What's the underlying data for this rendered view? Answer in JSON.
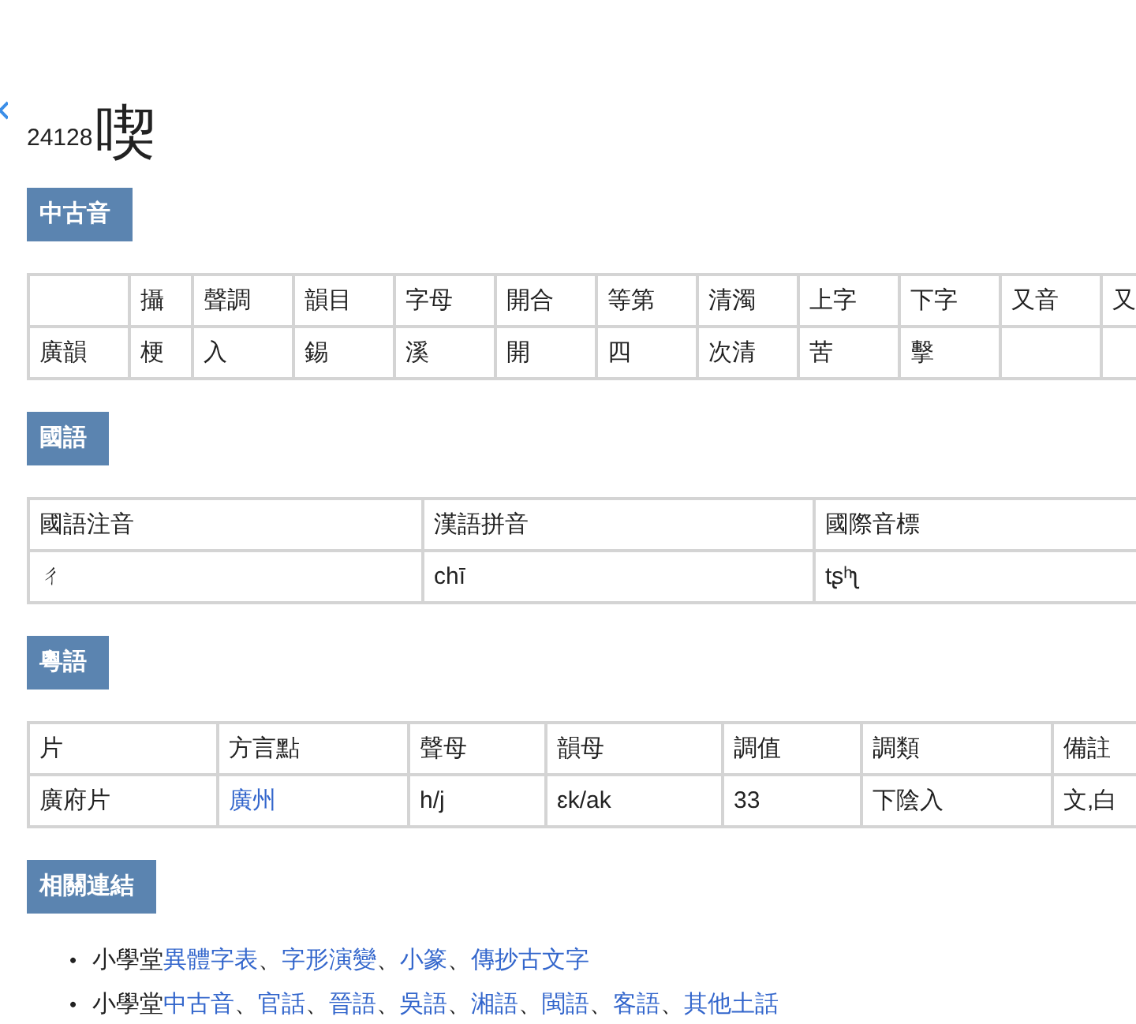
{
  "title": {
    "code": "24128",
    "character": "喫"
  },
  "sections": [
    {
      "heading": "中古音",
      "kind": "table",
      "columns": [
        null,
        "攝",
        "聲調",
        "韻目",
        "字母",
        "開合",
        "等第",
        "清濁",
        "上字",
        "下字",
        "又音",
        "又"
      ],
      "rows": [
        [
          {
            "text": "廣韻",
            "link": false
          },
          {
            "text": "梗",
            "link": false
          },
          {
            "text": "入",
            "link": false
          },
          {
            "text": "錫",
            "link": false
          },
          {
            "text": "溪",
            "link": false
          },
          {
            "text": "開",
            "link": false
          },
          {
            "text": "四",
            "link": false
          },
          {
            "text": "次清",
            "link": false
          },
          {
            "text": "苦",
            "link": false
          },
          {
            "text": "擊",
            "link": false
          },
          null,
          null
        ]
      ]
    },
    {
      "heading": "國語",
      "kind": "table",
      "columns": [
        "國語注音",
        "漢語拼音",
        "國際音標"
      ],
      "rows": [
        [
          {
            "text": "ㄔ",
            "link": false
          },
          {
            "text": "chī",
            "link": false
          },
          {
            "text": "tʂʰʅ",
            "link": false
          }
        ]
      ]
    },
    {
      "heading": "粵語",
      "kind": "table",
      "columns": [
        "片",
        "方言點",
        "聲母",
        "韻母",
        "調值",
        "調類",
        "備註"
      ],
      "rows": [
        [
          {
            "text": "廣府片",
            "link": false
          },
          {
            "text": "廣州",
            "link": true
          },
          {
            "text": "h/j",
            "link": false
          },
          {
            "text": "ɛk/ak",
            "link": false
          },
          {
            "text": "33",
            "link": false
          },
          {
            "text": "下陰入",
            "link": false
          },
          {
            "text": "文,白",
            "link": false
          }
        ]
      ]
    },
    {
      "heading": "相關連結",
      "kind": "list",
      "marker": "•",
      "separator": "、",
      "items": [
        {
          "prefix": "小學堂",
          "links": [
            "異體字表",
            "字形演變",
            "小篆",
            "傳抄古文字"
          ]
        },
        {
          "prefix": "小學堂",
          "links": [
            "中古音",
            "官話",
            "晉語",
            "吳語",
            "湘語",
            "閩語",
            "客語",
            "其他土話"
          ]
        }
      ]
    }
  ]
}
